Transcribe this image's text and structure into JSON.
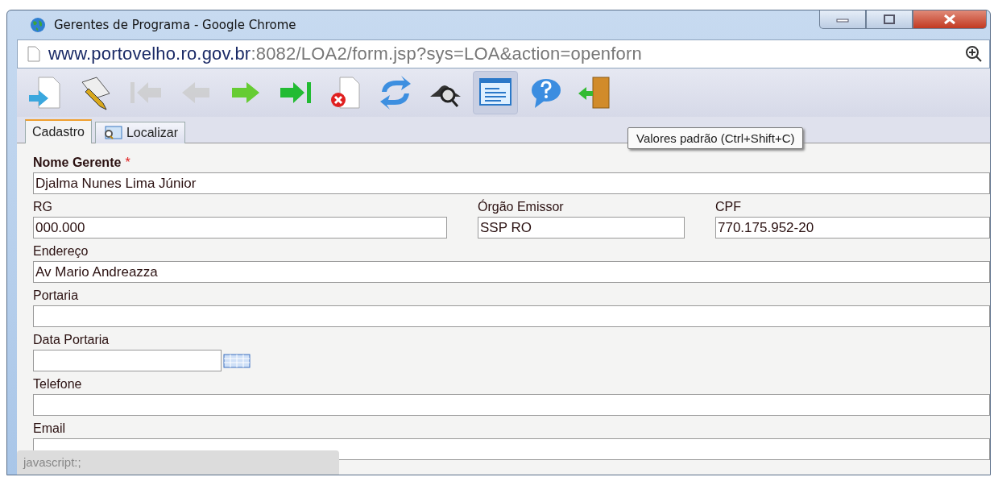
{
  "window": {
    "title": "Gerentes de Programa - Google Chrome"
  },
  "address_bar": {
    "host": "www.portovelho.ro.gov.br",
    "path": ":8082/LOA2/form.jsp?sys=LOA&action=openforn"
  },
  "toolbar": [
    {
      "kind": "new",
      "disabled": false,
      "highlighted": false
    },
    {
      "kind": "edit",
      "disabled": false,
      "highlighted": false
    },
    {
      "kind": "first",
      "disabled": true,
      "highlighted": false
    },
    {
      "kind": "previous",
      "disabled": true,
      "highlighted": false
    },
    {
      "kind": "next",
      "disabled": false,
      "highlighted": false
    },
    {
      "kind": "last",
      "disabled": false,
      "highlighted": false
    },
    {
      "kind": "delete",
      "disabled": false,
      "highlighted": false
    },
    {
      "kind": "refresh",
      "disabled": false,
      "highlighted": false
    },
    {
      "kind": "find",
      "disabled": false,
      "highlighted": false
    },
    {
      "kind": "defaults",
      "disabled": false,
      "highlighted": true
    },
    {
      "kind": "help",
      "disabled": false,
      "highlighted": false
    },
    {
      "kind": "exit",
      "disabled": false,
      "highlighted": false
    }
  ],
  "tooltip": "Valores padrão (Ctrl+Shift+C)",
  "tabs": [
    {
      "label": "Cadastro",
      "selected": true,
      "kind": "plain"
    },
    {
      "label": "Localizar",
      "selected": false,
      "kind": "search"
    }
  ],
  "form": {
    "rows": [
      [
        {
          "label": "Nome Gerente",
          "required_mark": "*",
          "value": "Djalma Nunes Lima Júnior",
          "kind": "text"
        }
      ],
      [
        {
          "label": "RG",
          "value": "000.000",
          "kind": "text"
        },
        {
          "label": "Órgão Emissor",
          "value": "SSP RO",
          "kind": "text"
        },
        {
          "label": "CPF",
          "value": "770.175.952-20",
          "kind": "text"
        }
      ],
      [
        {
          "label": "Endereço",
          "value": "Av Mario Andreazza",
          "kind": "text"
        }
      ],
      [
        {
          "label": "Portaria",
          "kind": "text"
        }
      ],
      [
        {
          "label": "Data Portaria",
          "kind": "date"
        }
      ],
      [
        {
          "label": "Telefone",
          "kind": "text"
        }
      ],
      [
        {
          "label": "Email",
          "kind": "text"
        }
      ]
    ]
  },
  "status_bar": "javascript:;"
}
